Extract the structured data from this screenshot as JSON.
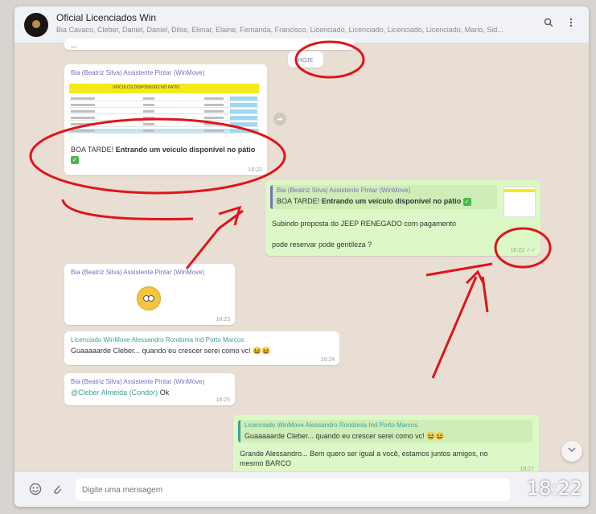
{
  "header": {
    "title": "Oficial Licenciados Win",
    "members": "Bia Cavaco, Cleber, Daniel, Daniel, Dilse, Elimar, Elaine, Fernanda, Francisco, Licenciado, Licenciado, Licenciado, Licenciado, Mario, Sid...",
    "search_icon": "search-icon",
    "menu_icon": "kebab-menu-icon"
  },
  "messages": {
    "top_partial": {
      "text": "...",
      "badge": "HOJE"
    },
    "image_msg": {
      "sender": "Bia (Beatriz Silva) Assistente Pintar (WinMove)",
      "spreadsheet_header": "VEICULOS DISPONIVEIS NO PATIO",
      "caption_prefix": "BOA TARDE!",
      "caption_bold": "Entrando um veículo disponível no pátio",
      "time": "16:22"
    },
    "reply_out": {
      "quoted_sender": "Bia (Beatriz Silva) Assistente Pintar (WinMove)",
      "quoted_prefix": "BOA TARDE!",
      "quoted_bold": "Entrando um veículo disponível no pátio",
      "line1": "Subindo proposta do JEEP RENEGADO com pagamento",
      "line2": "pode reservar pode gentileza ?",
      "time": "16:22"
    },
    "emoji_msg": {
      "sender": "Bia (Beatriz Silva) Assistente Pintar (WinMove)",
      "time": "16:23"
    },
    "cleber_msg": {
      "sender": "Licenciado WinMove Alessandro Rondonia Ind Porto Marcos",
      "text": "Guaaaaarde Cleber... quando eu crescer serei como vc!",
      "time": "16:24"
    },
    "ok_msg": {
      "sender": "Bia (Beatriz Silva) Assistente Pintar (WinMove)",
      "mention": "@Cleber Almeida (Condor)",
      "text": "Ok",
      "time": "16:25"
    },
    "final_out": {
      "quoted_sender": "Licenciado WinMove Alessandro Rondonia Ind Porto Marcos",
      "quoted_text": "Guaaaaarde Cleber... quando eu crescer serei como vc!",
      "text": "Grande Alessandro... Bem quero ser igual a você, estamos juntos amigos, no mesmo BARCO",
      "time": "16:27"
    }
  },
  "compose": {
    "placeholder": "Digite uma mensagem",
    "emoji_icon": "emoji-icon",
    "attach_icon": "paperclip-icon"
  },
  "overlay_clock": "18:22",
  "colors": {
    "incoming": "#ffffff",
    "outgoing": "#dcf8c6",
    "annotation": "#e0141a"
  }
}
